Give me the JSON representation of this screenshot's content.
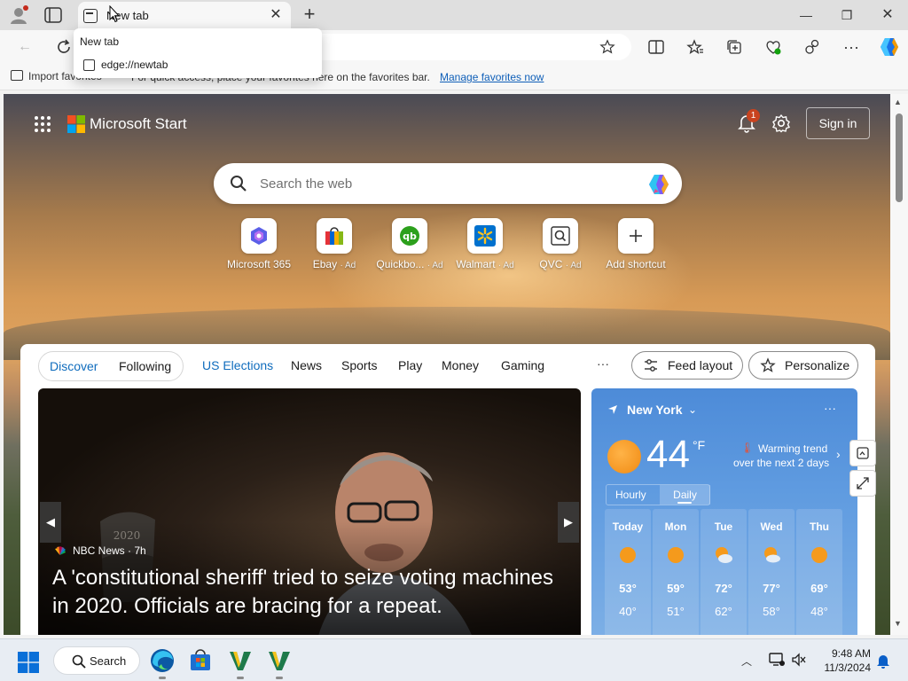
{
  "browser": {
    "tab_title": "New tab",
    "tooltip_title": "New tab",
    "tooltip_url": "edge://newtab",
    "favorites_bar": {
      "import_label": "Import favorites",
      "message": "For quick access, place your favorites here on the favorites bar.",
      "manage_link": "Manage favorites now"
    }
  },
  "page": {
    "brand": "Microsoft Start",
    "notification_count": "1",
    "sign_in": "Sign in",
    "search_placeholder": "Search the web",
    "shortcuts": [
      {
        "label": "Microsoft 365",
        "ad": ""
      },
      {
        "label": "Ebay",
        "ad": "· Ad"
      },
      {
        "label": "Quickbo...",
        "ad": "· Ad"
      },
      {
        "label": "Walmart",
        "ad": "· Ad"
      },
      {
        "label": "QVC",
        "ad": "· Ad"
      },
      {
        "label": "Add shortcut",
        "ad": ""
      }
    ],
    "nav": {
      "discover": "Discover",
      "following": "Following",
      "tabs": [
        "US Elections",
        "News",
        "Sports",
        "Play",
        "Money",
        "Gaming"
      ],
      "more": "···",
      "feed_layout": "Feed layout",
      "personalize": "Personalize"
    },
    "hero": {
      "source": "NBC News",
      "age": "· 7h",
      "headline": "A 'constitutional sheriff' tried to seize voting machines in 2020. Officials are bracing for a repeat."
    },
    "weather": {
      "location": "New York",
      "temp": "44",
      "unit": "°F",
      "trend_line1": "Warming trend",
      "trend_line2": "over the next 2 days",
      "tab_hourly": "Hourly",
      "tab_daily": "Daily",
      "days": [
        {
          "day": "Today",
          "icon": "sunny",
          "hi": "53°",
          "lo": "40°"
        },
        {
          "day": "Mon",
          "icon": "sunny",
          "hi": "59°",
          "lo": "51°"
        },
        {
          "day": "Tue",
          "icon": "partly-cloudy",
          "hi": "72°",
          "lo": "62°"
        },
        {
          "day": "Wed",
          "icon": "partly-cloudy",
          "hi": "77°",
          "lo": "58°"
        },
        {
          "day": "Thu",
          "icon": "sunny",
          "hi": "69°",
          "lo": "48°"
        }
      ]
    }
  },
  "taskbar": {
    "search_label": "Search",
    "time": "9:48 AM",
    "date": "11/3/2024"
  },
  "colors": {
    "accent": "#0f6cbd",
    "badge": "#c9431f",
    "weather_bg": "#5f9be0"
  }
}
